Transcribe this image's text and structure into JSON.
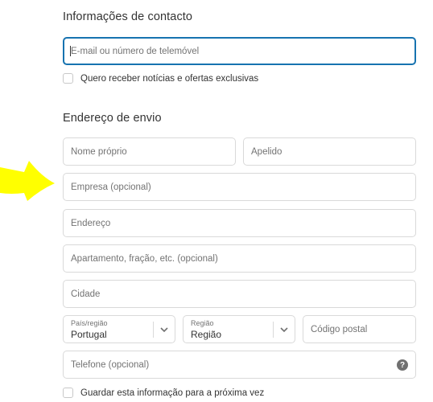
{
  "contact": {
    "title": "Informações de contacto",
    "email_placeholder": "E-mail ou número de telemóvel",
    "newsletter_label": "Quero receber notícias e ofertas exclusivas"
  },
  "shipping": {
    "title": "Endereço de envio",
    "first_name_placeholder": "Nome próprio",
    "last_name_placeholder": "Apelido",
    "company_placeholder": "Empresa (opcional)",
    "address_placeholder": "Endereço",
    "apartment_placeholder": "Apartamento, fração, etc. (opcional)",
    "city_placeholder": "Cidade",
    "country": {
      "label": "País/região",
      "value": "Portugal"
    },
    "region": {
      "label": "Região",
      "value": "Região"
    },
    "postal_code_placeholder": "Código postal",
    "phone_placeholder": "Telefone (opcional)",
    "save_info_label": "Guardar esta informação para a próxima vez"
  },
  "colors": {
    "focus_border": "#1773b0",
    "annotation_arrow": "#ffff00"
  },
  "icons": {
    "help": "question-mark-circle",
    "chevron": "chevron-down"
  }
}
